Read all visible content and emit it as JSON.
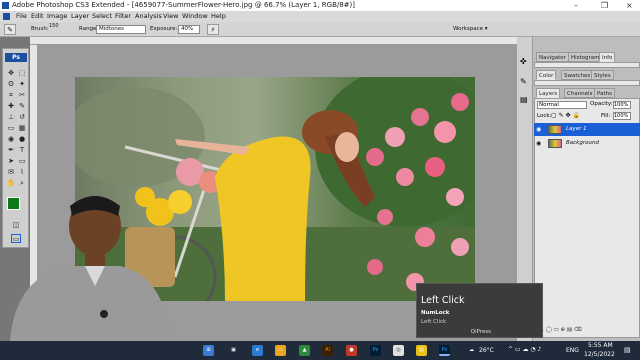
{
  "window": {
    "title": "Adobe Photoshop CS3 Extended - [4659077-SummerFlower-Hero.jpg @ 66.7% (Layer 1, RGB/8#)]",
    "controls": [
      "–",
      "❐",
      "×"
    ]
  },
  "menu": {
    "items": [
      "File",
      "Edit",
      "Image",
      "Layer",
      "Select",
      "Filter",
      "Analysis",
      "View",
      "Window",
      "Help"
    ]
  },
  "options_bar": {
    "brush_label": "Brush:",
    "brush_size": "150",
    "range_label": "Range:",
    "range_value": "Midtones",
    "exposure_label": "Exposure:",
    "exposure_value": "40%",
    "workspace_label": "Workspace ▾"
  },
  "toolbox": {
    "badge": "Ps",
    "foreground_color": "#0d7a17"
  },
  "panels": {
    "top_tabs": [
      "Navigator",
      "Histogram",
      "Info"
    ],
    "mid_tabs": [
      "Color",
      "Swatches",
      "Styles"
    ],
    "layer_tabs": [
      "Layers",
      "Channels",
      "Paths"
    ],
    "blend_mode": "Normal",
    "opacity_label": "Opacity:",
    "opacity_value": "100%",
    "lock_label": "Lock:",
    "fill_label": "Fill:",
    "fill_value": "100%",
    "layers": [
      {
        "name": "Layer 1",
        "selected": true
      },
      {
        "name": "Background",
        "selected": false
      }
    ],
    "footer_icons": "fx. ◯ ▭ ⊕ ▤ ⌫"
  },
  "notification": {
    "title": "Left Click",
    "line1": "NumLock",
    "line2": "Left Click",
    "brand": "QiPress"
  },
  "taskbar": {
    "weather": "26°C",
    "language": "ENG",
    "time": "5:55 AM",
    "date": "12/5/2022",
    "apps": [
      "Ai",
      "Ps",
      "Ps"
    ]
  },
  "colors": {
    "accent": "#1a5fd6",
    "photoshop_blue": "#1c4fa0",
    "taskbar": "#1f2a3a"
  }
}
